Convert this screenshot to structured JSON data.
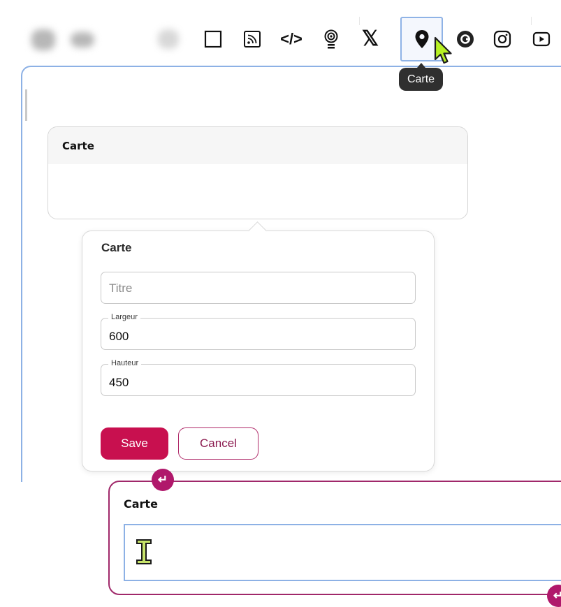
{
  "toolbar": {
    "tools": [
      {
        "name": "block",
        "icon": "square-icon"
      },
      {
        "name": "rss",
        "icon": "rss-icon"
      },
      {
        "name": "code",
        "icon": "code-icon",
        "glyph": "</>"
      },
      {
        "name": "podcast",
        "icon": "podcast-icon"
      },
      {
        "name": "x",
        "icon": "x-logo-icon",
        "glyph": "𝕏"
      },
      {
        "name": "map",
        "icon": "map-pin-icon",
        "active": true
      },
      {
        "name": "grammarly",
        "icon": "grammarly-icon"
      },
      {
        "name": "instagram",
        "icon": "instagram-icon"
      },
      {
        "name": "youtube",
        "icon": "youtube-icon"
      }
    ],
    "tooltip": "Carte"
  },
  "map_block": {
    "title": "Carte"
  },
  "popover": {
    "title": "Carte",
    "title_field": {
      "placeholder": "Titre",
      "value": ""
    },
    "width_field": {
      "label": "Largeur",
      "value": "600"
    },
    "height_field": {
      "label": "Hauteur",
      "value": "450"
    },
    "save_label": "Save",
    "cancel_label": "Cancel"
  },
  "bottom_block": {
    "title": "Carte",
    "badge_glyph": "↵"
  },
  "colors": {
    "accent": "#c8104f",
    "block_border": "#a0286a",
    "focus_blue": "#8db1e5",
    "tooltip_bg": "#2f2f2f"
  }
}
